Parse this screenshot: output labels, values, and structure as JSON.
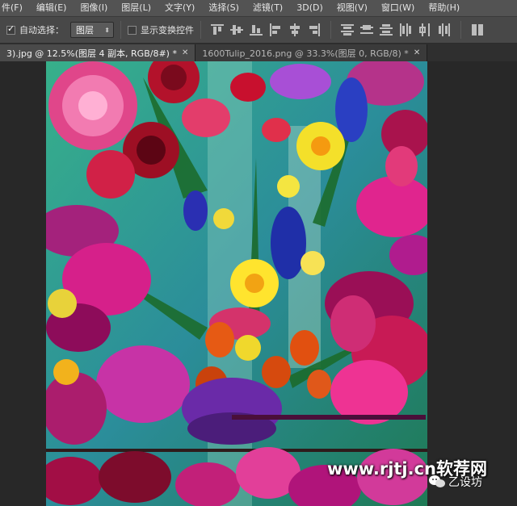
{
  "menubar": {
    "items": [
      "件(F)",
      "编辑(E)",
      "图像(I)",
      "图层(L)",
      "文字(Y)",
      "选择(S)",
      "滤镜(T)",
      "3D(D)",
      "视图(V)",
      "窗口(W)",
      "帮助(H)"
    ]
  },
  "options": {
    "auto_select_label": "自动选择：",
    "auto_select_checked": true,
    "target_value": "图层",
    "transform_controls_label": "显示变换控件",
    "transform_controls_checked": false
  },
  "tabs": [
    {
      "label": "3).jpg @ 12.5%(图层 4 副本, RGB/8#) *",
      "active": true
    },
    {
      "label": "1600Tulip_2016.png @ 33.3%(图层 0, RGB/8) *",
      "active": false
    }
  ],
  "watermark": {
    "site": "www.rjtj.cn软荐网",
    "account": "乙设坊"
  },
  "colors": {
    "menubar_bg": "#535353",
    "options_bg": "#484848",
    "workspace_bg": "#282828"
  }
}
